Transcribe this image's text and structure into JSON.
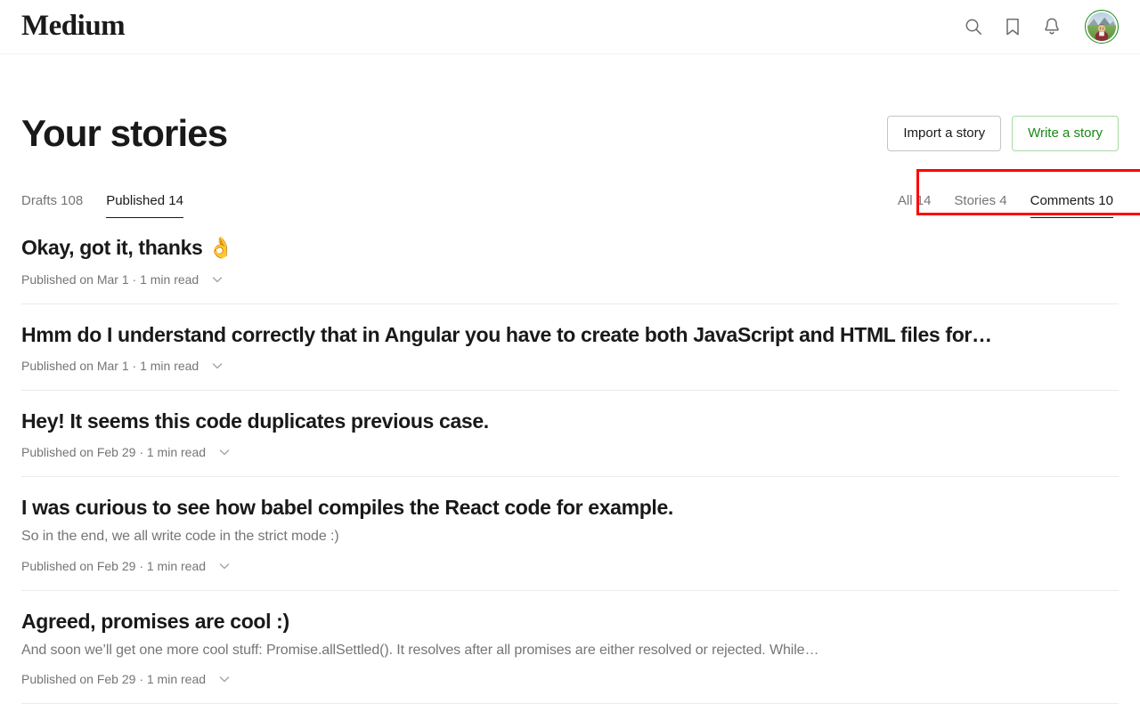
{
  "header": {
    "brand": "Medium",
    "icons": [
      {
        "name": "search-icon",
        "label": "Search"
      },
      {
        "name": "bookmark-icon",
        "label": "Bookmarks"
      },
      {
        "name": "notifications-bell-icon",
        "label": "Notifications"
      }
    ],
    "avatar_label": "Profile"
  },
  "page": {
    "title": "Your stories",
    "import_button": "Import a story",
    "write_button": "Write a story"
  },
  "left_tabs": [
    {
      "label": "Drafts 108",
      "active": false
    },
    {
      "label": "Published 14",
      "active": true
    }
  ],
  "right_tabs": [
    {
      "label": "All 14",
      "active": false
    },
    {
      "label": "Stories 4",
      "active": false
    },
    {
      "label": "Comments 10",
      "active": true
    }
  ],
  "highlight": {
    "color": "#ff0000"
  },
  "colors": {
    "accent_green": "#1a8917",
    "text_primary": "#191919",
    "text_secondary": "#757575",
    "divider": "#ebebeb",
    "highlight_red": "#ff0000"
  },
  "stories": [
    {
      "title": "Okay, got it, thanks ",
      "emoji": "👌",
      "excerpt": "",
      "meta": "Published on Mar 1 · 1 min read"
    },
    {
      "title": "Hmm do I understand correctly that in Angular you have to create both JavaScript and HTML files for…",
      "emoji": "",
      "excerpt": "",
      "meta": "Published on Mar 1 · 1 min read"
    },
    {
      "title": "Hey! It seems this code duplicates previous case.",
      "emoji": "",
      "excerpt": "",
      "meta": "Published on Feb 29 · 1 min read"
    },
    {
      "title": "I was curious to see how babel compiles the React code for example.",
      "emoji": "",
      "excerpt": "So in the end, we all write code in the strict mode :)",
      "meta": "Published on Feb 29 · 1 min read"
    },
    {
      "title": "Agreed, promises are cool :)",
      "emoji": "",
      "excerpt": "And soon we’ll get one more cool stuff: Promise.allSettled(). It resolves after all promises are either resolved or rejected. While…",
      "meta": "Published on Feb 29 · 1 min read"
    }
  ]
}
